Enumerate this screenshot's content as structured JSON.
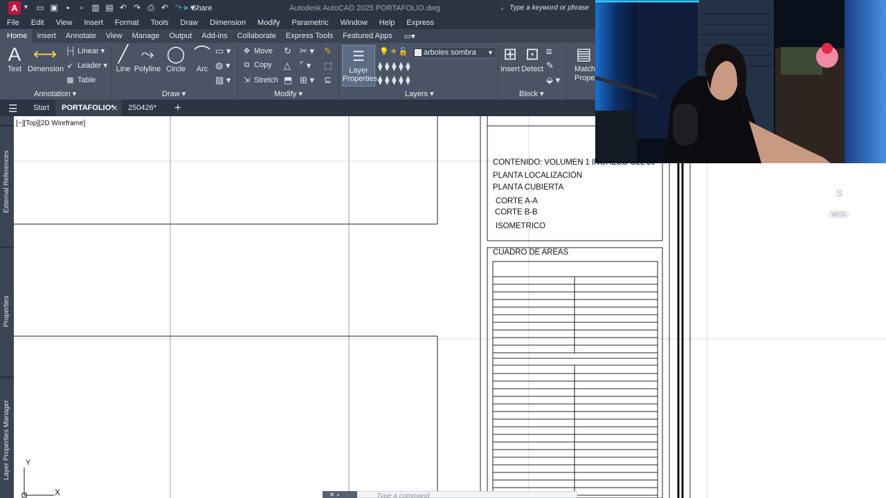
{
  "title_bar": {
    "app_logo": "A",
    "share_label": "Share",
    "window_title": "Autodesk AutoCAD 2025    PORTAFOLIO.dwg",
    "search_placeholder": "Type a keyword or phrase"
  },
  "menu": [
    "File",
    "Edit",
    "View",
    "Insert",
    "Format",
    "Tools",
    "Draw",
    "Dimension",
    "Modify",
    "Parametric",
    "Window",
    "Help",
    "Express"
  ],
  "ribbon_tabs": [
    "Home",
    "Insert",
    "Annotate",
    "View",
    "Manage",
    "Output",
    "Add-ins",
    "Collaborate",
    "Express Tools",
    "Featured Apps"
  ],
  "active_ribbon_tab": "Home",
  "ribbon": {
    "annotation": {
      "title": "Annotation",
      "text": "Text",
      "dimension": "Dimension",
      "linear": "Linear",
      "leader": "Leader",
      "table": "Table"
    },
    "draw": {
      "title": "Draw",
      "line": "Line",
      "polyline": "Polyline",
      "circle": "Circle",
      "arc": "Arc"
    },
    "modify": {
      "title": "Modify",
      "move": "Move",
      "copy": "Copy",
      "stretch": "Stretch"
    },
    "layers": {
      "title": "Layers",
      "layer_properties": "Layer Properties",
      "current_layer": "arboles sombra"
    },
    "block": {
      "title": "Block",
      "insert": "Insert",
      "detect": "Detect",
      "match_properties": "Match Properties"
    }
  },
  "file_tabs": {
    "start": "Start",
    "active": "PORTAFOLIO*",
    "other": "250426*"
  },
  "viewport": {
    "label": "[−][Top][2D Wireframe]"
  },
  "side_palettes": [
    "External References",
    "Properties",
    "Layer Properties Manager"
  ],
  "drawing": {
    "contents_lines": [
      "CONTENIDO: VOLUMEN 1 INGRESO CLL 30",
      "PLANTA LOCALIZACIÓN",
      "PLANTA CUBIERTA",
      "CORTE A-A",
      "CORTE B-B",
      "ISOMETRICO"
    ],
    "areas_title": "CUADRO DE AREAS"
  },
  "nav": {
    "south": "S",
    "wcs": "WCS"
  },
  "ucs": {
    "x": "X",
    "y": "Y"
  },
  "command_line": {
    "placeholder": "Type a command"
  },
  "colors": {
    "titlebar": "#2b3542",
    "ribbon": "#4a5464",
    "app_logo": "#c6143d",
    "share_icon": "#56a0e5",
    "canvas": "#ffffff"
  }
}
